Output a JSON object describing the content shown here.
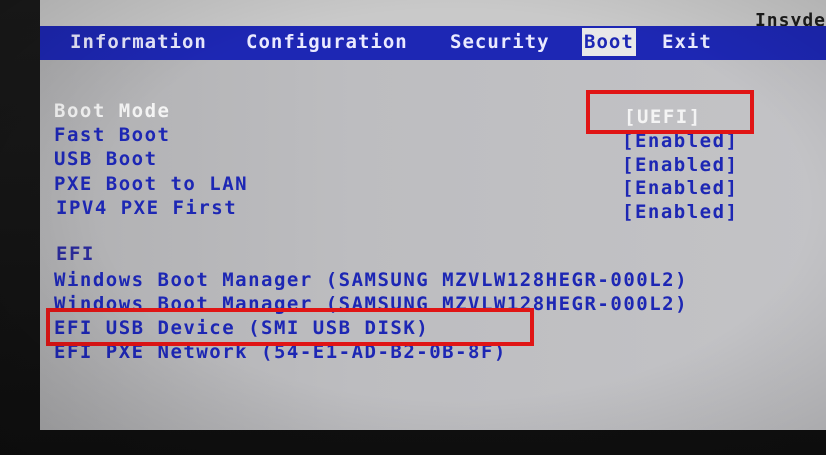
{
  "vendor": "Insyde",
  "tabs": [
    {
      "label": "Information"
    },
    {
      "label": "Configuration"
    },
    {
      "label": "Security"
    },
    {
      "label": "Boot"
    },
    {
      "label": "Exit"
    }
  ],
  "active_tab": "Boot",
  "settings": [
    {
      "label": "Boot Mode",
      "value": "[UEFI]"
    },
    {
      "label": "Fast Boot",
      "value": "[Enabled]"
    },
    {
      "label": "USB Boot",
      "value": "[Enabled]"
    },
    {
      "label": "PXE Boot to LAN",
      "value": "[Enabled]"
    },
    {
      "label": "IPV4 PXE First",
      "value": "[Enabled]"
    }
  ],
  "efi": {
    "heading": "EFI",
    "items": [
      {
        "label": "Windows Boot Manager (SAMSUNG MZVLW128HEGR-000L2)"
      },
      {
        "label": "Windows Boot Manager (SAMSUNG MZVLW128HEGR-000L2)"
      },
      {
        "label": "EFI USB Device (SMI      USB DISK)"
      },
      {
        "label": "EFI PXE Network (54-E1-AD-B2-0B-8F)"
      }
    ]
  },
  "colors": {
    "background": "#bdbdc0",
    "tabbar": "#1d27b4",
    "text": "#1d27b4",
    "selected_text": "#f4f4f4",
    "highlight_box": "#e01515"
  }
}
